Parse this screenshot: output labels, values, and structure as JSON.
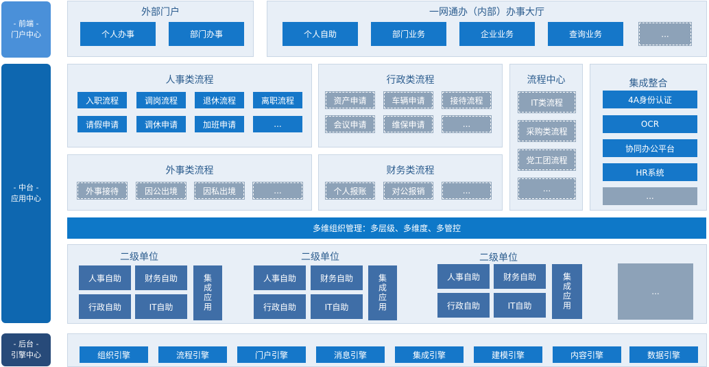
{
  "sidebar": {
    "front": [
      "- 前端 -",
      "门户中心"
    ],
    "middle": [
      "- 中台 -",
      "应用中心"
    ],
    "back": [
      "- 后台 -",
      "引擎中心"
    ]
  },
  "portal_external": {
    "title": "外部门户",
    "items": [
      "个人办事",
      "部门办事"
    ]
  },
  "portal_internal": {
    "title": "一网通办（内部）办事大厅",
    "items": [
      "个人自助",
      "部门业务",
      "企业业务",
      "查询业务",
      "..."
    ]
  },
  "hr": {
    "title": "人事类流程",
    "items": [
      "入职流程",
      "调岗流程",
      "退休流程",
      "离职流程",
      "请假申请",
      "调休申请",
      "加班申请",
      "..."
    ]
  },
  "admin": {
    "title": "行政类流程",
    "items": [
      "资产申请",
      "车辆申请",
      "接待流程",
      "会议申请",
      "维保申请",
      "..."
    ]
  },
  "foreign": {
    "title": "外事类流程",
    "items": [
      "外事接待",
      "因公出境",
      "因私出境",
      "..."
    ]
  },
  "finance": {
    "title": "财务类流程",
    "items": [
      "个人报账",
      "对公报销",
      "..."
    ]
  },
  "process_center": {
    "title": "流程中心",
    "items": [
      "IT类流程",
      "采购类流程",
      "党工团流程",
      "..."
    ]
  },
  "integration": {
    "title": "集成整合",
    "items": [
      "4A身份认证",
      "OCR",
      "协同办公平台",
      "HR系统",
      "..."
    ]
  },
  "org_bar": "多维组织管理：多层级、多维度、多管控",
  "units": [
    {
      "title": "二级单位",
      "items": [
        "人事自助",
        "财务自助",
        "行政自助",
        "IT自助"
      ],
      "app": "集成应用"
    },
    {
      "title": "二级单位",
      "items": [
        "人事自助",
        "财务自助",
        "行政自助",
        "IT自助"
      ],
      "app": "集成应用"
    },
    {
      "title": "二级单位",
      "items": [
        "人事自助",
        "财务自助",
        "行政自助",
        "IT自助"
      ],
      "app": "集成应用"
    }
  ],
  "units_more": "...",
  "engines": [
    "组织引擎",
    "流程引擎",
    "门户引擎",
    "消息引擎",
    "集成引擎",
    "建模引擎",
    "内容引擎",
    "数据引擎"
  ],
  "colors": {
    "primary": "#1577c9",
    "dark_blue": "#3f6ea7",
    "gray_block": "#8da2b8",
    "panel_bg": "#e8eff7"
  }
}
